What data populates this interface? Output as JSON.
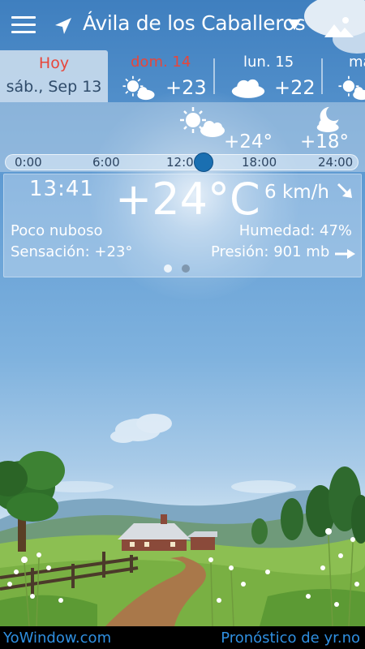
{
  "header": {
    "city": "Ávila de los Caballeros",
    "icons": [
      "menu-icon",
      "location-arrow-icon",
      "caret-down-icon",
      "landscape-icon"
    ]
  },
  "days": [
    {
      "name": "Hoy",
      "date": "sáb., Sep 13",
      "active": true
    },
    {
      "name": "dom. 14",
      "temp": "+23",
      "icon": "sun-cloud-icon",
      "color": "#e8463a"
    },
    {
      "name": "lun. 15",
      "temp": "+22",
      "icon": "cloud-icon",
      "color": "#ffffff"
    },
    {
      "name": "ma",
      "temp": "",
      "icon": "sun-cloud-icon",
      "color": "#ffffff"
    }
  ],
  "hourly": {
    "forecast": [
      {
        "temp": "+24°",
        "icon": "sun-cloud-icon"
      },
      {
        "temp": "+18°",
        "icon": "moon-cloud-icon"
      }
    ],
    "timeline_labels": [
      "0:00",
      "6:00",
      "12:00",
      "18:00",
      "24:00"
    ],
    "current_time_fraction": 0.57
  },
  "current": {
    "time": "13:41",
    "temperature": "+24°C",
    "wind": "6 km/h",
    "condition": "Poco nuboso",
    "feels_like": "Sensación: +23°",
    "humidity": "Humedad: 47%",
    "pressure": "Presión: 901 mb",
    "page_count": 2,
    "active_page": 1
  },
  "footer": {
    "left_link": "YoWindow.com",
    "right_link": "Pronóstico de yr.no"
  },
  "colors": {
    "accent": "#1a6fb1",
    "today_red": "#e8463a",
    "link_blue": "#2f8fe0",
    "footer_bg": "#000000"
  }
}
